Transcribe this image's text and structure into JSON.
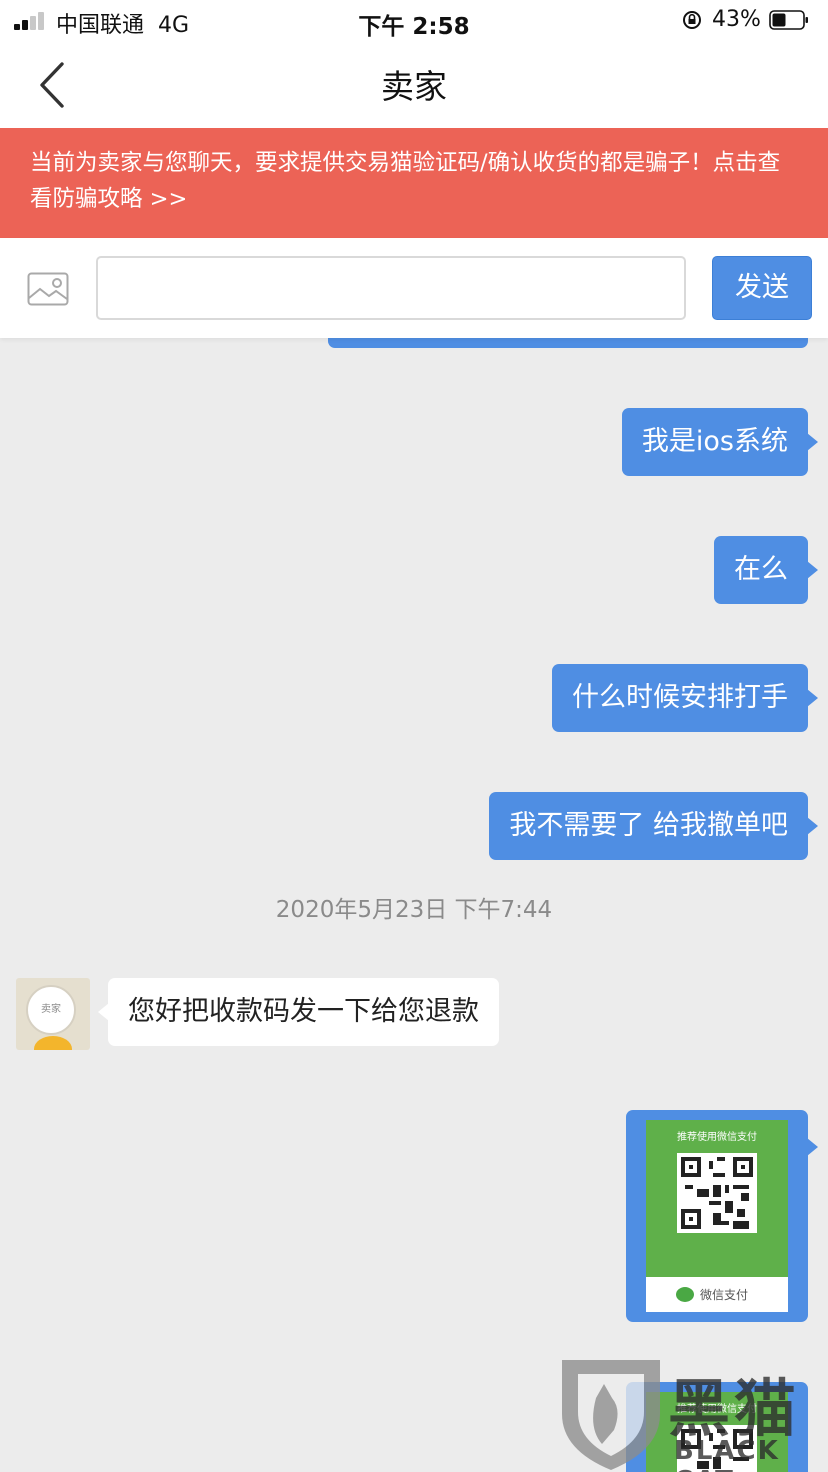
{
  "status_bar": {
    "carrier": "中国联通",
    "network": "4G",
    "time": "下午 2:58",
    "battery_percent": "43%",
    "signal_bars": 2,
    "battery_level": 0.43
  },
  "nav": {
    "title": "卖家",
    "back_icon": "chevron-left-icon"
  },
  "warning_banner": {
    "text": "当前为卖家与您聊天，要求提供交易猫验证码/确认收货的都是骗子！点击查看防骗攻略 >>",
    "background_color": "#ec6356"
  },
  "composer": {
    "image_icon": "image-icon",
    "input_value": "",
    "input_placeholder": "",
    "send_label": "发送",
    "accent_color": "#4f8ee3"
  },
  "messages": [
    {
      "from": "me",
      "text": "我是ios系统"
    },
    {
      "from": "me",
      "text": "在么"
    },
    {
      "from": "me",
      "text": "什么时候安排打手"
    },
    {
      "from": "me",
      "text": "我不需要了 给我撤单吧"
    },
    {
      "type": "timestamp",
      "text": "2020年5月23日 下午7:44"
    },
    {
      "from": "seller",
      "text": "您好把收款码发一下给您退款",
      "avatar_label": "卖家"
    },
    {
      "from": "me",
      "type": "image",
      "title": "推荐使用微信支付",
      "footer": "微信支付"
    },
    {
      "from": "me",
      "type": "image",
      "title": "推荐使用微信支付"
    }
  ],
  "watermark": {
    "text_zh": "黑猫",
    "text_en": "BLACK CAT"
  }
}
